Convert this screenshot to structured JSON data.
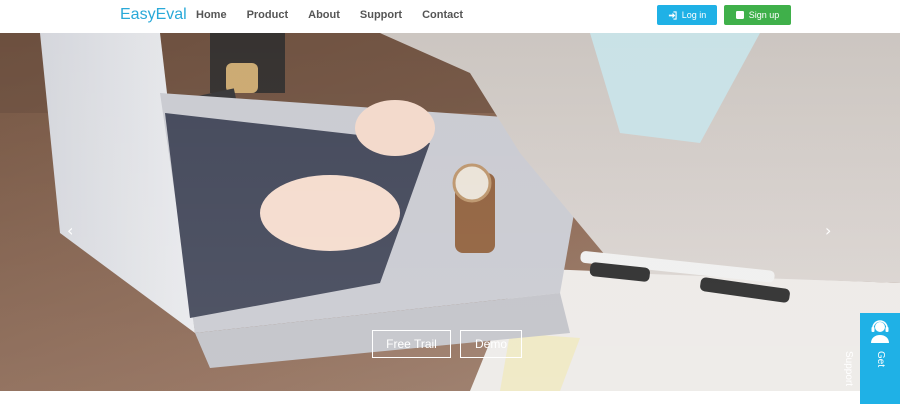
{
  "brand": {
    "name": "EasyEval"
  },
  "nav": {
    "items": [
      {
        "label": "Home"
      },
      {
        "label": "Product"
      },
      {
        "label": "About"
      },
      {
        "label": "Support"
      },
      {
        "label": "Contact"
      }
    ]
  },
  "auth": {
    "login_label": "Log in",
    "login_icon": "sign-in-icon",
    "signup_label": "Sign up",
    "signup_icon": "user-square-icon",
    "login_color": "#1fb1e6",
    "signup_color": "#3fb04a"
  },
  "hero": {
    "prev_arrow": "‹",
    "next_arrow": "›",
    "cta_primary": "Free Trail",
    "cta_secondary": "Demo"
  },
  "support_widget": {
    "label": "Get Support",
    "icon": "headset-user-icon",
    "color": "#1fb1e6"
  },
  "colors": {
    "brand": "#29a9d8"
  }
}
